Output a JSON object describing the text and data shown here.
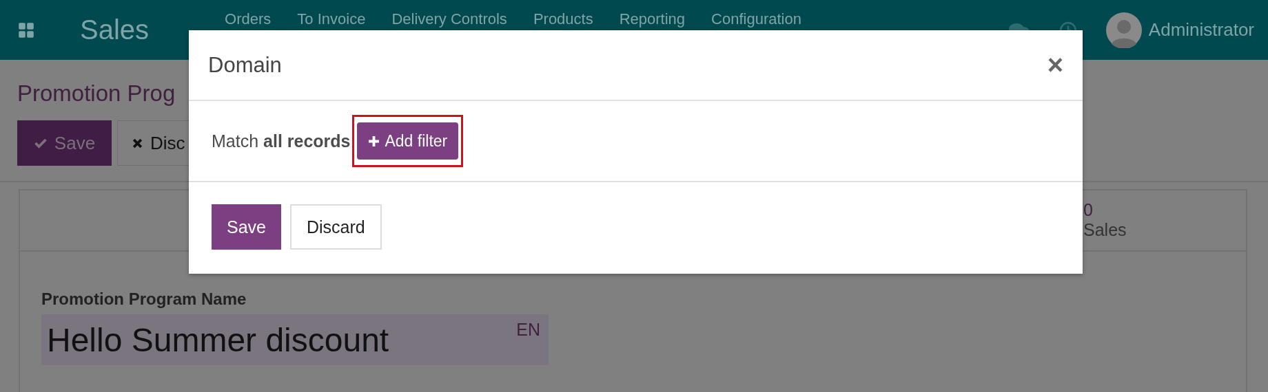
{
  "topbar": {
    "app_name": "Sales",
    "menu": [
      {
        "label": "Orders"
      },
      {
        "label": "To Invoice"
      },
      {
        "label": "Delivery Controls"
      },
      {
        "label": "Products"
      },
      {
        "label": "Reporting"
      },
      {
        "label": "Configuration"
      }
    ],
    "user": "Administrator"
  },
  "control_panel": {
    "breadcrumb": "Promotion Prog",
    "buttons": [
      {
        "label": "Save",
        "kind": "primary"
      },
      {
        "label": "Disc",
        "kind": "secondary"
      }
    ]
  },
  "form": {
    "stat_button": {
      "value": "0",
      "label": "Sales"
    },
    "field_label": "Promotion Program Name",
    "field_value": "Hello Summer discount",
    "language": "EN"
  },
  "dialog": {
    "title": "Domain",
    "close": "×",
    "match_text": "Match **all records**",
    "add_filter": {
      "label": "Add filter",
      "highlighted": true
    },
    "buttons": [
      {
        "label": "Save",
        "kind": "primary"
      },
      {
        "label": "Discard",
        "kind": "secondary"
      }
    ]
  }
}
